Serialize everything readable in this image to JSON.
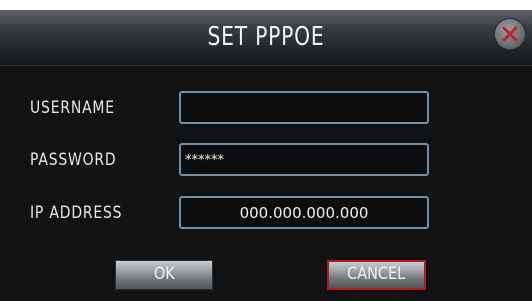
{
  "dialog": {
    "title": "SET PPPOE",
    "close_icon": "close-icon"
  },
  "fields": {
    "username": {
      "label": "USERNAME",
      "value": ""
    },
    "password": {
      "label": "PASSWORD",
      "value": "******"
    },
    "ip_address": {
      "label": "IP ADDRESS",
      "value": "000.000.000.000"
    }
  },
  "buttons": {
    "ok_label": "OK",
    "cancel_label": "CANCEL"
  },
  "colors": {
    "background": "#101214",
    "field_border": "#6f8fa6",
    "cancel_border": "#b01c1c",
    "text": "#f2f2f2"
  }
}
